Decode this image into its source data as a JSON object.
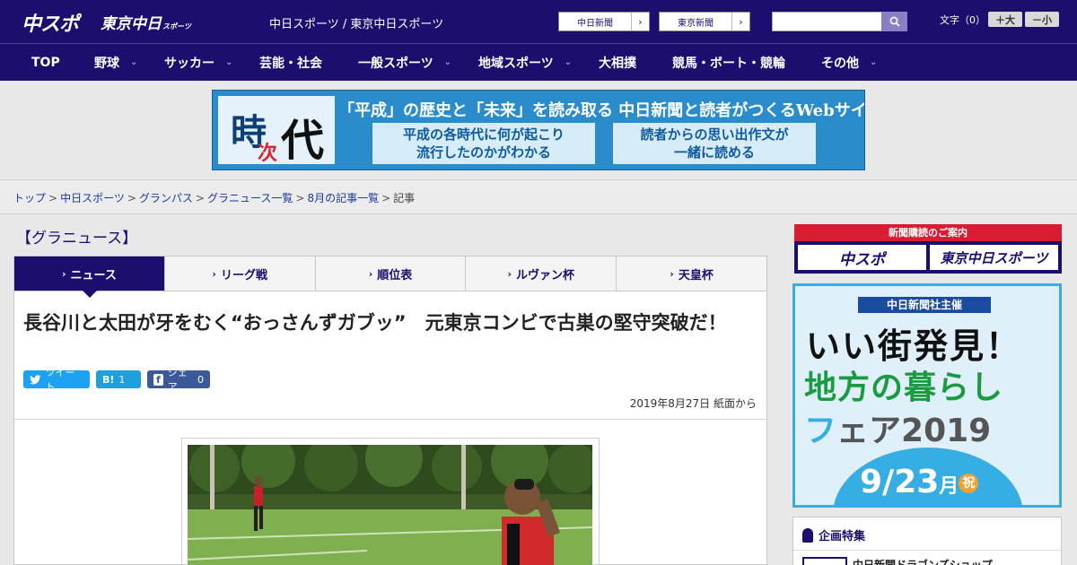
{
  "header": {
    "logo_chuspo": "中スポ",
    "logo_tokyo": "東京中日",
    "logo_tokyo_sub": "スポーツ",
    "site_title": "中日スポーツ / 東京中日スポーツ",
    "links": [
      {
        "label": "中日新聞",
        "arrow": "›"
      },
      {
        "label": "東京新聞",
        "arrow": "›"
      }
    ],
    "search": {
      "value": ""
    },
    "font_size": {
      "label": "文字（0）",
      "larger": "＋大",
      "smaller": "－小"
    }
  },
  "nav": {
    "items": [
      {
        "label": "TOP",
        "has_dropdown": false
      },
      {
        "label": "野球",
        "has_dropdown": true
      },
      {
        "label": "サッカー",
        "has_dropdown": true
      },
      {
        "label": "芸能・社会",
        "has_dropdown": false
      },
      {
        "label": "一般スポーツ",
        "has_dropdown": true
      },
      {
        "label": "地域スポーツ",
        "has_dropdown": true
      },
      {
        "label": "大相撲",
        "has_dropdown": false
      },
      {
        "label": "競馬・ボート・競輪",
        "has_dropdown": false
      },
      {
        "label": "その他",
        "has_dropdown": true
      }
    ],
    "chevron": "⌄"
  },
  "banner": {
    "logo_ji": "時",
    "logo_tsugi": "次",
    "logo_dai": "代",
    "headline": "「平成」の歴史と「未来」を読み取る 中日新聞と読者がつくるWebサイト",
    "box1_line1": "平成の各時代に何が起こり",
    "box1_line2": "流行したのかがわかる",
    "box2_line1": "読者からの思い出作文が",
    "box2_line2": "一緒に読める"
  },
  "breadcrumb": {
    "items": [
      "トップ",
      "中日スポーツ",
      "グランパス",
      "グラニュース一覧",
      "8月の記事一覧"
    ],
    "current": "記事",
    "separator": ">"
  },
  "section": {
    "heading": "【グラニュース】"
  },
  "tabs": {
    "items": [
      {
        "label": "ニュース",
        "active": true
      },
      {
        "label": "リーグ戦",
        "active": false
      },
      {
        "label": "順位表",
        "active": false
      },
      {
        "label": "ルヴァン杯",
        "active": false
      },
      {
        "label": "天皇杯",
        "active": false
      }
    ],
    "chevron": "›"
  },
  "article": {
    "title": "長谷川と太田が牙をむく“おっさんずガブッ”　元東京コンビで古巣の堅守突破だ！",
    "date": "2019年8月27日 紙面から",
    "share": {
      "tweet": {
        "icon": "🐦",
        "label": "ツイート"
      },
      "hatena": {
        "icon": "B!",
        "count": "1"
      },
      "facebook": {
        "icon": "f",
        "label": "シェア",
        "count": "0"
      }
    }
  },
  "sidebar": {
    "subscribe": {
      "title": "新聞購読のご案内",
      "logo_chuspo": "中スポ",
      "logo_tokyo": "東京中日スポーツ"
    },
    "fair_ad": {
      "sponsor": "中日新聞社主催",
      "line1": "いい街発見！",
      "line2": "地方の暮らし",
      "line3_a": "フ",
      "line3_b": "ェア2019",
      "date_main": "9/23",
      "date_day": "月",
      "date_holiday": "祝"
    },
    "special": {
      "heading": "企画特集",
      "item_label": "中日新聞ドラゴンズショップ"
    }
  },
  "colors": {
    "brand_navy": "#1a0e6e",
    "accent_red": "#d81d33",
    "twitter": "#1da1f2",
    "hatena": "#1f9fdb",
    "facebook": "#3b5998"
  }
}
